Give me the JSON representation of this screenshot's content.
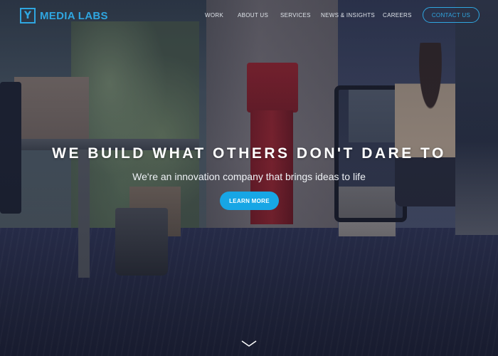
{
  "brand": {
    "logo_mark": "Y",
    "name": "MEDIA LABS",
    "accent_color": "#2fa6e0"
  },
  "nav": {
    "items": [
      {
        "label": "WORK"
      },
      {
        "label": "ABOUT US"
      },
      {
        "label": "SERVICES"
      },
      {
        "label": "NEWS & INSIGHTS"
      },
      {
        "label": "CAREERS"
      }
    ],
    "contact_label": "CONTACT US"
  },
  "hero": {
    "title": "WE BUILD WHAT OTHERS DON'T DARE TO",
    "subtitle": "We're an innovation company that brings ideas to life",
    "cta_label": "LEARN MORE",
    "cta_color": "#17a6e5",
    "background": "office-photo"
  },
  "scroll_indicator": {
    "icon": "chevron-down-icon"
  }
}
